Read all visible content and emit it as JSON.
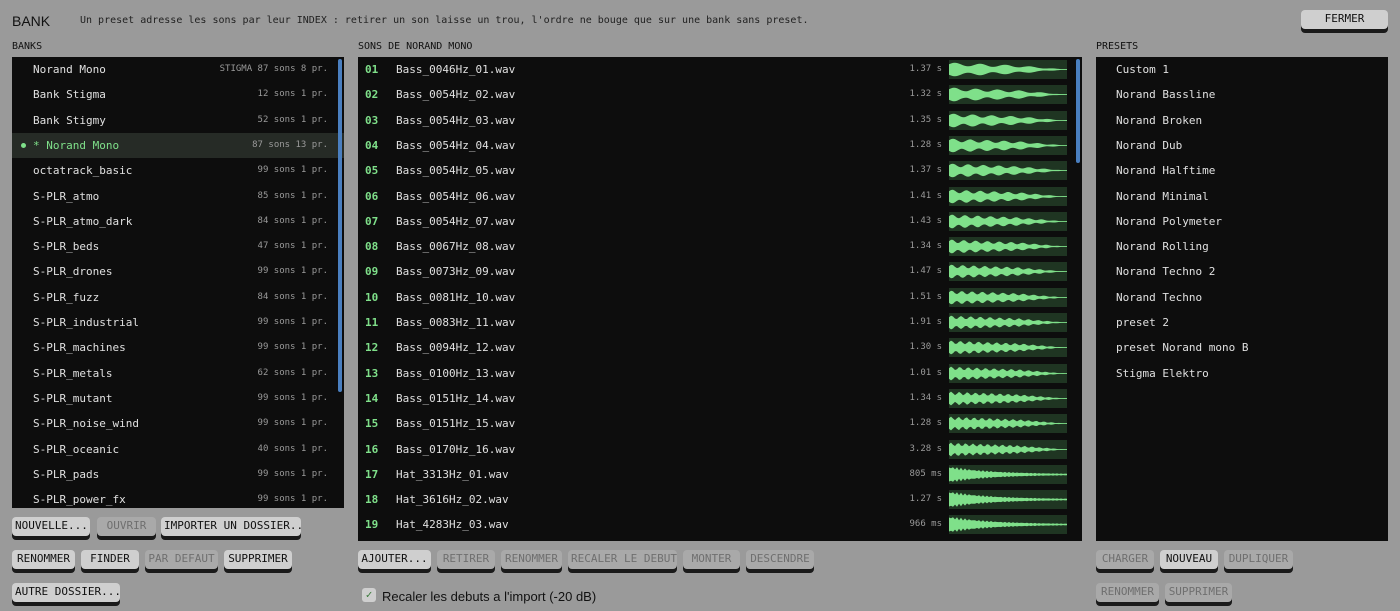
{
  "header": {
    "title": "BANK",
    "hint": "Un preset adresse les sons par leur INDEX : retirer un son laisse un trou, l'ordre ne bouge que sur une bank sans preset.",
    "close_label": "FERMER"
  },
  "banks": {
    "label": "BANKS",
    "items": [
      {
        "name": "Norand Mono",
        "meta": "STIGMA  87 sons  8 pr.",
        "selected": false
      },
      {
        "name": "Bank Stigma",
        "meta": "12 sons  1 pr.",
        "selected": false
      },
      {
        "name": "Bank Stigmy",
        "meta": "52 sons  1 pr.",
        "selected": false
      },
      {
        "name": "* Norand Mono",
        "meta": "87 sons  13 pr.",
        "selected": true
      },
      {
        "name": "octatrack_basic",
        "meta": "99 sons  1 pr.",
        "selected": false
      },
      {
        "name": "S-PLR_atmo",
        "meta": "85 sons  1 pr.",
        "selected": false
      },
      {
        "name": "S-PLR_atmo_dark",
        "meta": "84 sons  1 pr.",
        "selected": false
      },
      {
        "name": "S-PLR_beds",
        "meta": "47 sons  1 pr.",
        "selected": false
      },
      {
        "name": "S-PLR_drones",
        "meta": "99 sons  1 pr.",
        "selected": false
      },
      {
        "name": "S-PLR_fuzz",
        "meta": "84 sons  1 pr.",
        "selected": false
      },
      {
        "name": "S-PLR_industrial",
        "meta": "99 sons  1 pr.",
        "selected": false
      },
      {
        "name": "S-PLR_machines",
        "meta": "99 sons  1 pr.",
        "selected": false
      },
      {
        "name": "S-PLR_metals",
        "meta": "62 sons  1 pr.",
        "selected": false
      },
      {
        "name": "S-PLR_mutant",
        "meta": "99 sons  1 pr.",
        "selected": false
      },
      {
        "name": "S-PLR_noise_wind",
        "meta": "99 sons  1 pr.",
        "selected": false
      },
      {
        "name": "S-PLR_oceanic",
        "meta": "40 sons  1 pr.",
        "selected": false
      },
      {
        "name": "S-PLR_pads",
        "meta": "99 sons  1 pr.",
        "selected": false
      },
      {
        "name": "S-PLR_power_fx",
        "meta": "99 sons  1 pr.",
        "selected": false
      }
    ],
    "buttons": {
      "new": "NOUVELLE...",
      "open": "OUVRIR",
      "import": "IMPORTER UN DOSSIER..",
      "rename": "RENOMMER",
      "finder": "FINDER",
      "default": "PAR DEFAUT",
      "delete": "SUPPRIMER",
      "other": "AUTRE DOSSIER..."
    }
  },
  "sounds": {
    "label": "SONS DE NORAND MONO",
    "items": [
      {
        "idx": "01",
        "name": "Bass_0046Hz_01.wav",
        "dur": "1.37 s"
      },
      {
        "idx": "02",
        "name": "Bass_0054Hz_02.wav",
        "dur": "1.32 s"
      },
      {
        "idx": "03",
        "name": "Bass_0054Hz_03.wav",
        "dur": "1.35 s"
      },
      {
        "idx": "04",
        "name": "Bass_0054Hz_04.wav",
        "dur": "1.28 s"
      },
      {
        "idx": "05",
        "name": "Bass_0054Hz_05.wav",
        "dur": "1.37 s"
      },
      {
        "idx": "06",
        "name": "Bass_0054Hz_06.wav",
        "dur": "1.41 s"
      },
      {
        "idx": "07",
        "name": "Bass_0054Hz_07.wav",
        "dur": "1.43 s"
      },
      {
        "idx": "08",
        "name": "Bass_0067Hz_08.wav",
        "dur": "1.34 s"
      },
      {
        "idx": "09",
        "name": "Bass_0073Hz_09.wav",
        "dur": "1.47 s"
      },
      {
        "idx": "10",
        "name": "Bass_0081Hz_10.wav",
        "dur": "1.51 s"
      },
      {
        "idx": "11",
        "name": "Bass_0083Hz_11.wav",
        "dur": "1.91 s"
      },
      {
        "idx": "12",
        "name": "Bass_0094Hz_12.wav",
        "dur": "1.30 s"
      },
      {
        "idx": "13",
        "name": "Bass_0100Hz_13.wav",
        "dur": "1.01 s"
      },
      {
        "idx": "14",
        "name": "Bass_0151Hz_14.wav",
        "dur": "1.34 s"
      },
      {
        "idx": "15",
        "name": "Bass_0151Hz_15.wav",
        "dur": "1.28 s"
      },
      {
        "idx": "16",
        "name": "Bass_0170Hz_16.wav",
        "dur": "3.28 s"
      },
      {
        "idx": "17",
        "name": "Hat_3313Hz_01.wav",
        "dur": "805 ms"
      },
      {
        "idx": "18",
        "name": "Hat_3616Hz_02.wav",
        "dur": "1.27 s"
      },
      {
        "idx": "19",
        "name": "Hat_4283Hz_03.wav",
        "dur": "966 ms"
      }
    ],
    "buttons": {
      "add": "AJOUTER...",
      "remove": "RETIRER",
      "rename": "RENOMMER",
      "trim": "RECALER LE DEBUT",
      "up": "MONTER",
      "down": "DESCENDRE"
    },
    "checkbox_label": "Recaler les debuts a l'import (-20 dB)",
    "checkbox_checked": true
  },
  "presets": {
    "label": "PRESETS",
    "items": [
      "Custom 1",
      "Norand Bassline",
      "Norand Broken",
      "Norand Dub",
      "Norand Halftime",
      "Norand Minimal",
      "Norand Polymeter",
      "Norand Rolling",
      "Norand Techno 2",
      "Norand Techno",
      "preset 2",
      "preset Norand mono B",
      "Stigma Elektro"
    ],
    "buttons": {
      "load": "CHARGER",
      "new": "NOUVEAU",
      "duplicate": "DUPLIQUER",
      "rename": "RENOMMER",
      "delete": "SUPPRIMER"
    }
  },
  "colors": {
    "accent": "#7fe08a",
    "panel_bg": "#0d0d0d",
    "app_bg": "#9a9a9a",
    "scrollbar": "#4a7fc0"
  }
}
